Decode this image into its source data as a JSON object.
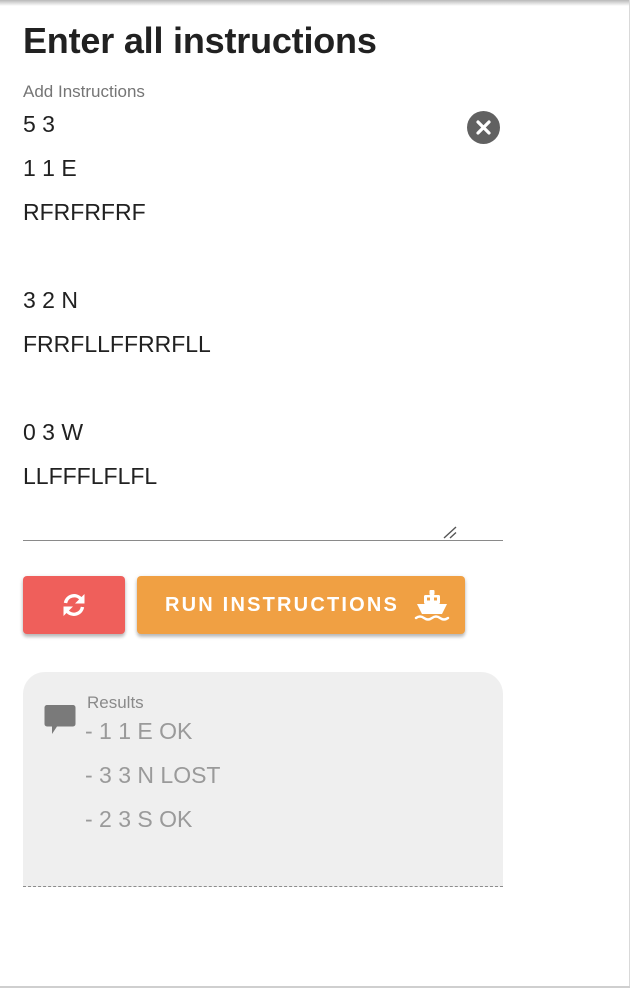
{
  "page": {
    "title": "Enter all instructions"
  },
  "instructions": {
    "label": "Add Instructions",
    "lines": [
      "5 3",
      "1 1 E",
      "RFRFRFRF",
      "",
      "3 2 N",
      "FRRFLLFFRRFLL",
      "",
      "0 3 W",
      "LLFFFLFLFL"
    ],
    "clear_icon": "close-circle-icon",
    "resize_icon": "resize-handle-icon"
  },
  "buttons": {
    "reset": {
      "icon": "refresh-icon",
      "color": "#ef5f5b"
    },
    "run": {
      "label": "RUN INSTRUCTIONS",
      "icon": "ship-icon",
      "color": "#f0a043"
    }
  },
  "results": {
    "label": "Results",
    "icon": "comment-icon",
    "lines": [
      "- 1 1 E OK",
      "- 3 3 N LOST",
      "- 2 3 S OK"
    ]
  }
}
